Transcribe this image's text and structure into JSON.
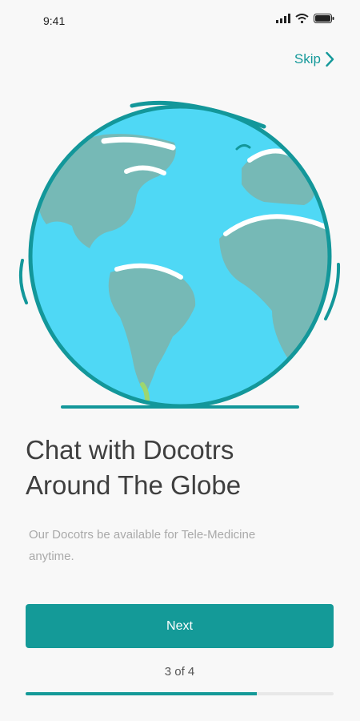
{
  "status_bar": {
    "time": "9:41",
    "icons": [
      "signal-icon",
      "wifi-icon",
      "battery-icon"
    ]
  },
  "skip": {
    "label": "Skip",
    "icon": "chevron-right-icon"
  },
  "illustration": {
    "icon": "globe-icon",
    "colors": {
      "ocean": "#4fd8f5",
      "land": "#76b9b6",
      "outline": "#13979a"
    }
  },
  "onboarding": {
    "title_line1": "Chat with Docotrs",
    "title_line2": "Around The Globe",
    "subtitle_line1": "Our Docotrs be available for Tele-Medicine",
    "subtitle_line2": "anytime."
  },
  "next_button": {
    "label": "Next"
  },
  "pagination": {
    "current": 3,
    "total": 4,
    "label": "3 of 4",
    "progress": 0.75
  },
  "colors": {
    "accent": "#149a98",
    "track": "#e8e8e8"
  }
}
